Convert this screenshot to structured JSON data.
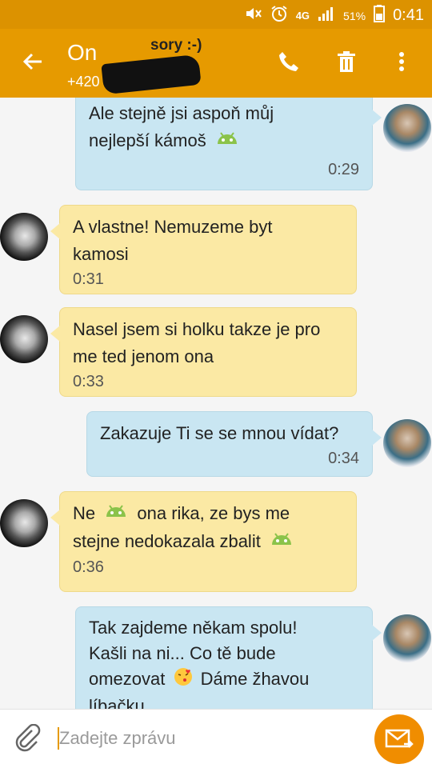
{
  "status_bar": {
    "network": "4G",
    "battery": "51%",
    "time": "0:41"
  },
  "header": {
    "contact_name": "On",
    "contact_number": "+420",
    "annotation": "sory :-)"
  },
  "messages": [
    {
      "direction": "outgoing",
      "lines": [
        "Ale stejně jsi aspoň můj",
        "nejlepší kámoš"
      ],
      "time": "0:29"
    },
    {
      "direction": "incoming",
      "lines": [
        "A vlastne! Nemuzeme byt",
        "kamosi"
      ],
      "time": "0:31"
    },
    {
      "direction": "incoming",
      "lines": [
        "Nasel jsem si holku takze je pro",
        "me ted jenom ona"
      ],
      "time": "0:33"
    },
    {
      "direction": "outgoing",
      "lines": [
        "Zakazuje Ti se se mnou vídat?"
      ],
      "time": "0:34"
    },
    {
      "direction": "incoming",
      "lines": [
        "Ne",
        "ona rika, ze bys me",
        "stejne nedokazala zbalit"
      ],
      "time": "0:36"
    },
    {
      "direction": "outgoing",
      "lines": [
        "Tak zajdeme někam spolu!",
        "Kašli na ni... Co tě bude",
        "omezovat",
        "Dáme žhavou",
        "líbačku"
      ],
      "time": ""
    }
  ],
  "composer": {
    "placeholder": "Zadejte zprávu"
  },
  "colors": {
    "app_bar": "#e69a00",
    "status_bar": "#dc9200",
    "outgoing_bubble": "#c9e6f2",
    "incoming_bubble": "#fbe9a4",
    "send_button": "#f08d00"
  }
}
